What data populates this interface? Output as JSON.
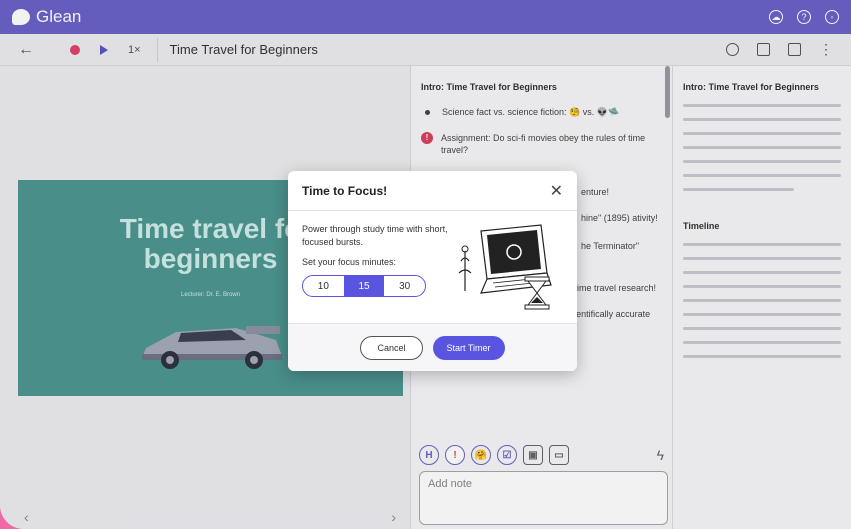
{
  "app": {
    "name": "Glean"
  },
  "toolbar": {
    "speed": "1×",
    "document_title": "Time Travel for Beginners"
  },
  "slide": {
    "title_line1": "Time travel fo",
    "title_line2": "beginners",
    "lecturer": "Lecturer: Dr. E. Brown"
  },
  "pager": {
    "prev": "‹",
    "next": "›"
  },
  "notes": {
    "heading": "Intro: Time Travel for Beginners",
    "items": [
      {
        "type": "bullet",
        "text": "Science fact vs. science fiction: 🧐 vs. 👽🛸"
      },
      {
        "type": "warn",
        "text": "Assignment: Do sci-fi movies obey the rules of time travel?"
      },
      {
        "type": "bullet",
        "text": "enture!"
      },
      {
        "type": "bullet",
        "text": "hine\" (1895) ativity!"
      },
      {
        "type": "bullet",
        "text": "he Terminator\""
      },
      {
        "type": "warn",
        "text": "\"Contact\" by Carl Sagan inspired time travel research!"
      },
      {
        "type": "bullet",
        "text": "📽 \"Interstellar\" (2014) = most scientifically accurate time travel film"
      }
    ],
    "tools": [
      "H",
      "!",
      "🤗",
      "☑"
    ],
    "add_note_placeholder": "Add note"
  },
  "outline": {
    "heading": "Intro: Time Travel for Beginners",
    "timeline_heading": "Timeline"
  },
  "dialog": {
    "title": "Time to Focus!",
    "description": "Power through study time with short, focused bursts.",
    "label": "Set your focus minutes:",
    "options": [
      "10",
      "15",
      "30"
    ],
    "selected": "15",
    "cancel": "Cancel",
    "start": "Start Timer"
  },
  "colors": {
    "brand": "#6a63c8",
    "accent": "#5a55e0",
    "record": "#e2416a",
    "slide_bg": "#4d9691"
  }
}
